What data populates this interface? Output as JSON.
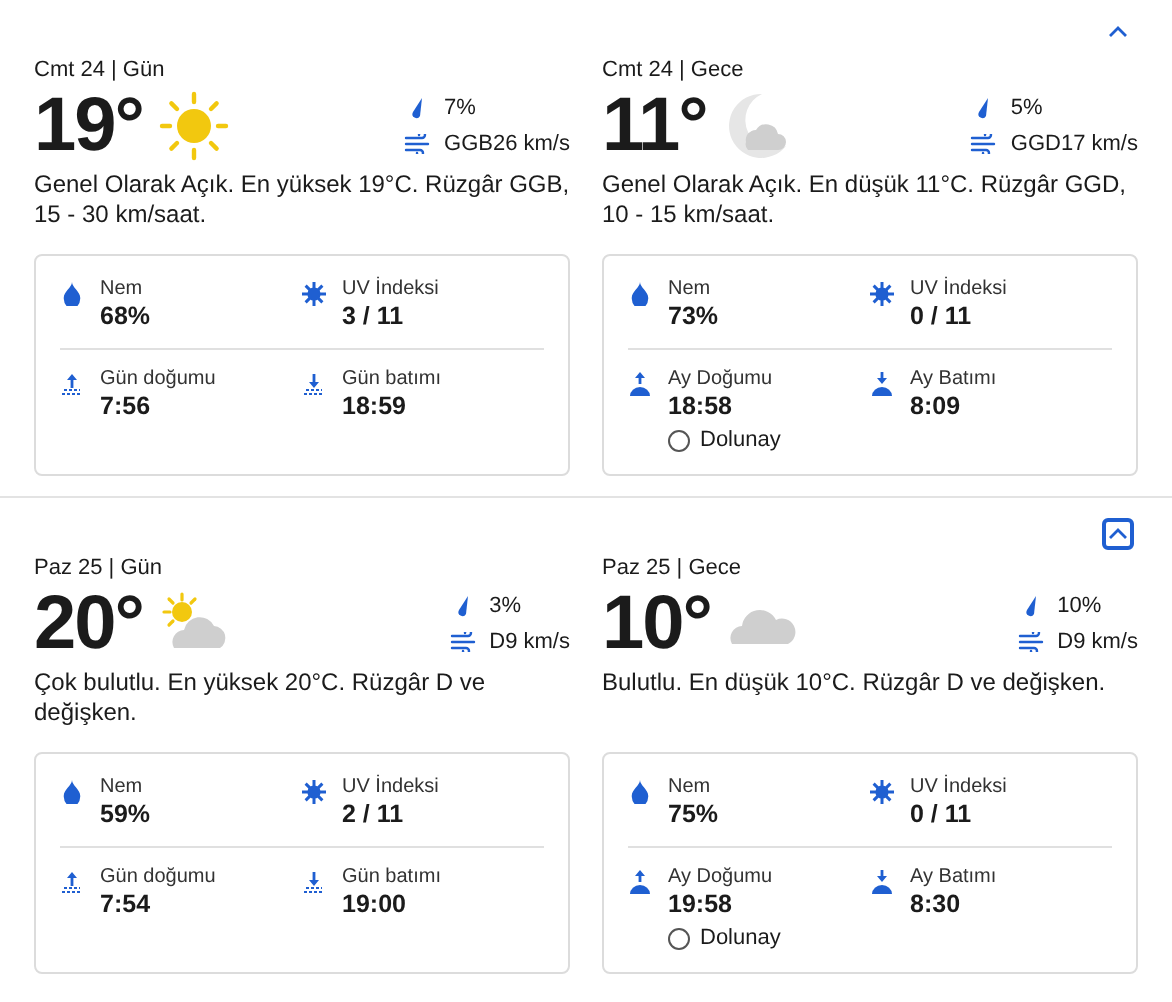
{
  "days": [
    {
      "toggle": {
        "focused": false
      },
      "periods": [
        {
          "header": "Cmt 24 | Gün",
          "temperature": "19°",
          "kind": "sun",
          "precipitation": "7%",
          "wind": "GGB26 km/s",
          "description": "Genel Olarak Açık. En yüksek 19°C. Rüzgâr GGB, 15 - 30 km/saat.",
          "details": [
            {
              "kind": "humidity",
              "label": "Nem",
              "value": "68%"
            },
            {
              "kind": "uv",
              "label": "UV İndeksi",
              "value": "3 / 11"
            },
            {
              "kind": "sunrise",
              "label": "Gün doğumu",
              "value": "7:56"
            },
            {
              "kind": "sunset",
              "label": "Gün batımı",
              "value": "18:59"
            }
          ]
        },
        {
          "header": "Cmt 24 | Gece",
          "temperature": "11°",
          "kind": "moon",
          "precipitation": "5%",
          "wind": "GGD17 km/s",
          "description": "Genel Olarak Açık. En düşük 11°C. Rüzgâr GGD, 10 - 15 km/saat.",
          "details": [
            {
              "kind": "humidity",
              "label": "Nem",
              "value": "73%"
            },
            {
              "kind": "uv",
              "label": "UV İndeksi",
              "value": "0 / 11"
            },
            {
              "kind": "moonrise",
              "label": "Ay Doğumu",
              "value": "18:58"
            },
            {
              "kind": "moonset",
              "label": "Ay Batımı",
              "value": "8:09"
            }
          ],
          "moon_phase": "Dolunay"
        }
      ]
    },
    {
      "toggle": {
        "focused": true
      },
      "periods": [
        {
          "header": "Paz 25 | Gün",
          "temperature": "20°",
          "kind": "partly",
          "precipitation": "3%",
          "wind": "D9 km/s",
          "description": "Çok bulutlu. En yüksek 20°C. Rüzgâr D ve değişken.",
          "details": [
            {
              "kind": "humidity",
              "label": "Nem",
              "value": "59%"
            },
            {
              "kind": "uv",
              "label": "UV İndeksi",
              "value": "2 / 11"
            },
            {
              "kind": "sunrise",
              "label": "Gün doğumu",
              "value": "7:54"
            },
            {
              "kind": "sunset",
              "label": "Gün batımı",
              "value": "19:00"
            }
          ]
        },
        {
          "header": "Paz 25 | Gece",
          "temperature": "10°",
          "kind": "cloud",
          "precipitation": "10%",
          "wind": "D9 km/s",
          "description": "Bulutlu. En düşük 10°C. Rüzgâr D ve değişken.",
          "details": [
            {
              "kind": "humidity",
              "label": "Nem",
              "value": "75%"
            },
            {
              "kind": "uv",
              "label": "UV İndeksi",
              "value": "0 / 11"
            },
            {
              "kind": "moonrise",
              "label": "Ay Doğumu",
              "value": "19:58"
            },
            {
              "kind": "moonset",
              "label": "Ay Batımı",
              "value": "8:30"
            }
          ],
          "moon_phase": "Dolunay"
        }
      ]
    }
  ]
}
